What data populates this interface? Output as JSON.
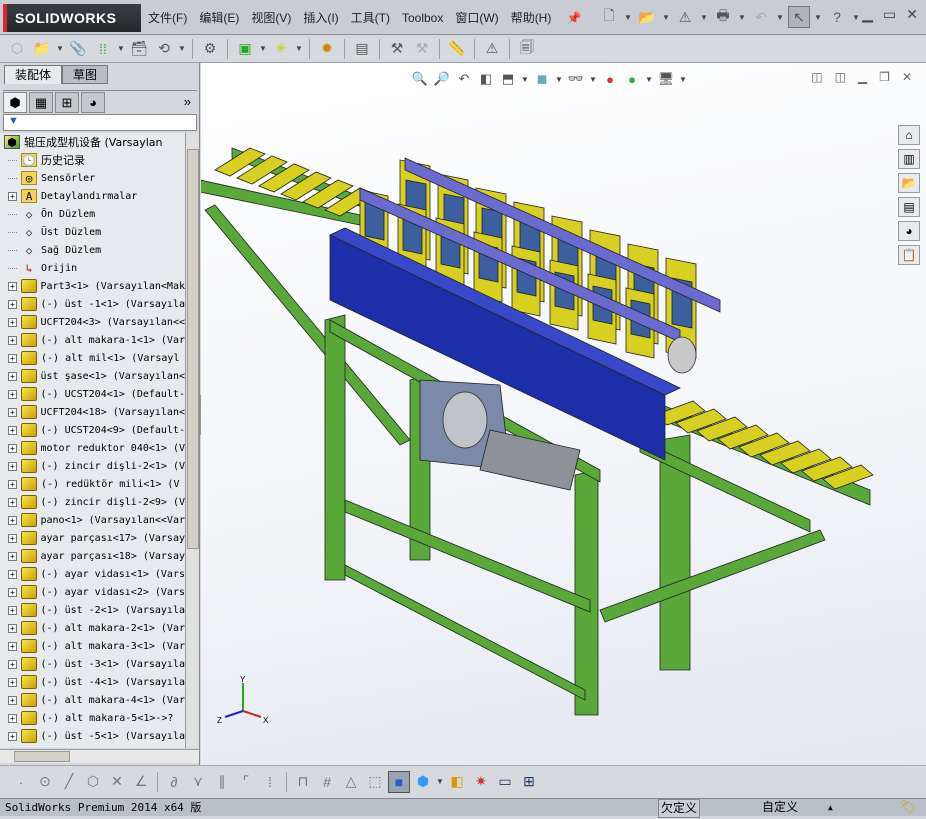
{
  "app": {
    "logo": "SOLIDWORKS"
  },
  "menu": [
    "文件(F)",
    "编辑(E)",
    "视图(V)",
    "插入(I)",
    "工具(T)",
    "Toolbox",
    "窗口(W)",
    "帮助(H)"
  ],
  "panel": {
    "tabs": [
      "装配体",
      "草图"
    ],
    "more": "»",
    "filter_icon": "filter-icon",
    "tree": [
      {
        "label": "辊压成型机设备  (Varsaylan",
        "type": "root"
      },
      {
        "label": "历史记录",
        "type": "history"
      },
      {
        "label": "Sensörler",
        "type": "sensor"
      },
      {
        "label": "Detaylandırmalar",
        "type": "annotation",
        "expand": true
      },
      {
        "label": "Ön Düzlem",
        "type": "plane"
      },
      {
        "label": "Üst Düzlem",
        "type": "plane"
      },
      {
        "label": "Sağ Düzlem",
        "type": "plane"
      },
      {
        "label": "Orijin",
        "type": "origin"
      },
      {
        "label": "Part3<1> (Varsayılan<Mak",
        "type": "part",
        "expand": true
      },
      {
        "label": "(-) üst -1<1> (Varsayıla",
        "type": "part",
        "expand": true
      },
      {
        "label": "UCFT204<3> (Varsayılan<<",
        "type": "part",
        "expand": true
      },
      {
        "label": "(-) alt makara-1<1> (Var",
        "type": "part",
        "expand": true
      },
      {
        "label": "(-) alt mil<1> (Varsayl",
        "type": "part",
        "expand": true
      },
      {
        "label": "üst şase<1> (Varsayılan<",
        "type": "part",
        "expand": true
      },
      {
        "label": "(-) UCST204<1> (Default-",
        "type": "part",
        "expand": true
      },
      {
        "label": "UCFT204<18> (Varsayılan<",
        "type": "part",
        "expand": true
      },
      {
        "label": "(-) UCST204<9> (Default-",
        "type": "part",
        "expand": true
      },
      {
        "label": "motor reduktor 040<1> (V",
        "type": "part",
        "expand": true
      },
      {
        "label": "(-) zincir dişli-2<1> (V",
        "type": "part",
        "expand": true
      },
      {
        "label": "(-) redüktör mili<1> (V",
        "type": "part",
        "expand": true
      },
      {
        "label": "(-) zincir dişli-2<9> (V",
        "type": "part",
        "expand": true
      },
      {
        "label": "pano<1> (Varsayılan<<Var",
        "type": "part",
        "expand": true
      },
      {
        "label": "ayar parçası<17> (Varsay",
        "type": "part",
        "expand": true
      },
      {
        "label": "ayar parçası<18> (Varsay",
        "type": "part",
        "expand": true
      },
      {
        "label": "(-) ayar vidası<1> (Vars",
        "type": "part",
        "expand": true
      },
      {
        "label": "(-) ayar vidası<2> (Vars",
        "type": "part",
        "expand": true
      },
      {
        "label": "(-) üst -2<1> (Varsayıla",
        "type": "part",
        "expand": true
      },
      {
        "label": "(-) alt makara-2<1> (Var",
        "type": "part",
        "expand": true
      },
      {
        "label": "(-) alt makara-3<1> (Var",
        "type": "part",
        "expand": true
      },
      {
        "label": "(-) üst -3<1> (Varsayıla",
        "type": "part",
        "expand": true
      },
      {
        "label": "(-) üst -4<1> (Varsayıla",
        "type": "part",
        "expand": true
      },
      {
        "label": "(-) alt makara-4<1> (Var",
        "type": "part",
        "expand": true
      },
      {
        "label": "(-) alt makara-5<1>->?",
        "type": "part",
        "expand": true
      },
      {
        "label": "(-) üst -5<1> (Varsayıla",
        "type": "part",
        "expand": true
      }
    ]
  },
  "triad": {
    "x": "X",
    "y": "Y",
    "z": "Z"
  },
  "status": {
    "version": "SolidWorks Premium 2014 x64 版",
    "state": "欠定义",
    "custom": "自定义"
  },
  "colors": {
    "frame": "#5aa83a",
    "beam": "#1c2fa8",
    "roller": "#d8d020",
    "accent": "#d8282e"
  }
}
